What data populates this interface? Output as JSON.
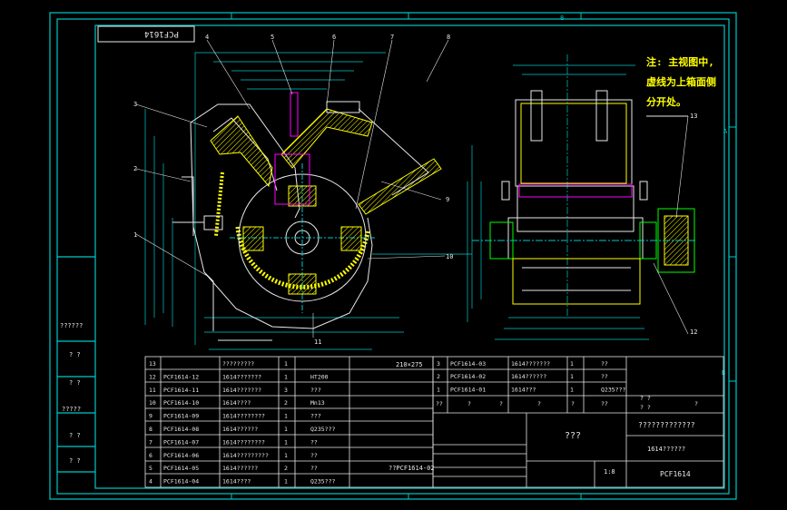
{
  "drawing": {
    "code_box": "PCF1614",
    "note_lines": [
      "注: 主视图中,",
      "虚线为上箱面侧",
      "分开处。"
    ],
    "side_marks": {
      "A": "A",
      "B": "B",
      "top_center": "8"
    },
    "left_panel_labels": [
      "??????",
      "? ?",
      "? ?",
      "?????",
      "? ?",
      "? ?"
    ],
    "callouts": [
      "1",
      "2",
      "3",
      "4",
      "5",
      "6",
      "7",
      "8",
      "9",
      "10",
      "11",
      "12",
      "13"
    ],
    "dim_label": "210×275",
    "colors": {
      "frame": "#00c8c8",
      "linework": "#e8e8e8",
      "hatch": "#ffff00",
      "magenta": "#ff00ff",
      "green": "#00ff00",
      "note": "#ffff00",
      "background": "#000000"
    }
  },
  "bom_left": [
    {
      "no": "13",
      "code": "",
      "name": "?????????",
      "qty": "1",
      "material": ""
    },
    {
      "no": "12",
      "code": "PCF1614-12",
      "name": "1614???????",
      "qty": "1",
      "material": "HT200"
    },
    {
      "no": "11",
      "code": "PCF1614-11",
      "name": "1614???????",
      "qty": "3",
      "material": "???"
    },
    {
      "no": "10",
      "code": "PCF1614-10",
      "name": "1614????",
      "qty": "2",
      "material": "Mn13"
    },
    {
      "no": "9",
      "code": "PCF1614-09",
      "name": "1614????????",
      "qty": "1",
      "material": "???"
    },
    {
      "no": "8",
      "code": "PCF1614-08",
      "name": "1614??????",
      "qty": "1",
      "material": "Q235???"
    },
    {
      "no": "7",
      "code": "PCF1614-07",
      "name": "1614????????",
      "qty": "1",
      "material": "??"
    },
    {
      "no": "6",
      "code": "PCF1614-06",
      "name": "1614?????????",
      "qty": "1",
      "material": "??"
    },
    {
      "no": "5",
      "code": "PCF1614-05",
      "name": "1614??????",
      "qty": "2",
      "material": "??"
    },
    {
      "no": "4",
      "code": "PCF1614-04",
      "name": "1614????",
      "qty": "1",
      "material": "Q235???"
    }
  ],
  "bom_right": [
    {
      "no": "3",
      "code": "PCF1614-03",
      "name": "1614???????",
      "qty": "1",
      "material": "??"
    },
    {
      "no": "2",
      "code": "PCF1614-02",
      "name": "1614??????",
      "qty": "1",
      "material": "??"
    },
    {
      "no": "1",
      "code": "PCF1614-01",
      "name": "1614???",
      "qty": "1",
      "material": "Q235???"
    }
  ],
  "bom_header": [
    "??",
    "?",
    "?",
    "?",
    "?",
    "??",
    "?",
    "? ?",
    "? ?"
  ],
  "title_block": {
    "company": "???",
    "drawing_name": "?????????????",
    "name2": "1614??????",
    "drawing_no": "PCF1614",
    "scale": "1:8",
    "part_code_ref": "??PCF1614-02"
  }
}
